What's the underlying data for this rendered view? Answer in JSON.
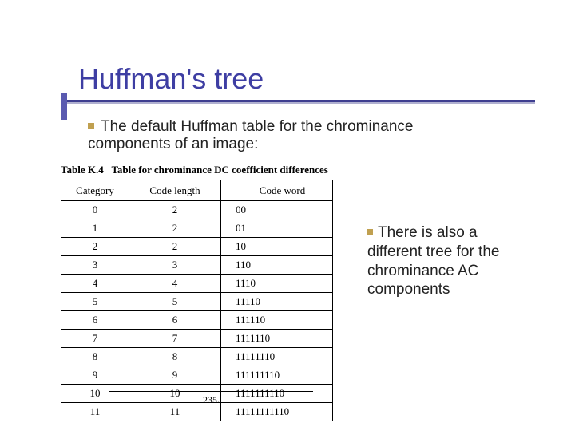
{
  "title": "Huffman's tree",
  "bullet1_line1": "The default Huffman table for the chrominance",
  "bullet1_line2": "components of an image:",
  "table_caption_label": "Table K.4",
  "table_caption_text": "Table for chrominance DC coefficient differences",
  "headers": {
    "c0": "Category",
    "c1": "Code length",
    "c2": "Code word"
  },
  "rows": [
    {
      "cat": "0",
      "len": "2",
      "word": "00"
    },
    {
      "cat": "1",
      "len": "2",
      "word": "01"
    },
    {
      "cat": "2",
      "len": "2",
      "word": "10"
    },
    {
      "cat": "3",
      "len": "3",
      "word": "110"
    },
    {
      "cat": "4",
      "len": "4",
      "word": "1110"
    },
    {
      "cat": "5",
      "len": "5",
      "word": "11110"
    },
    {
      "cat": "6",
      "len": "6",
      "word": "111110"
    },
    {
      "cat": "7",
      "len": "7",
      "word": "1111110"
    },
    {
      "cat": "8",
      "len": "8",
      "word": "11111110"
    },
    {
      "cat": "9",
      "len": "9",
      "word": "111111110"
    },
    {
      "cat": "10",
      "len": "10",
      "word": "1111111110"
    },
    {
      "cat": "11",
      "len": "11",
      "word": "11111111110"
    }
  ],
  "page_number": "235.",
  "side_note": "There is also a different tree for the chrominance AC components"
}
